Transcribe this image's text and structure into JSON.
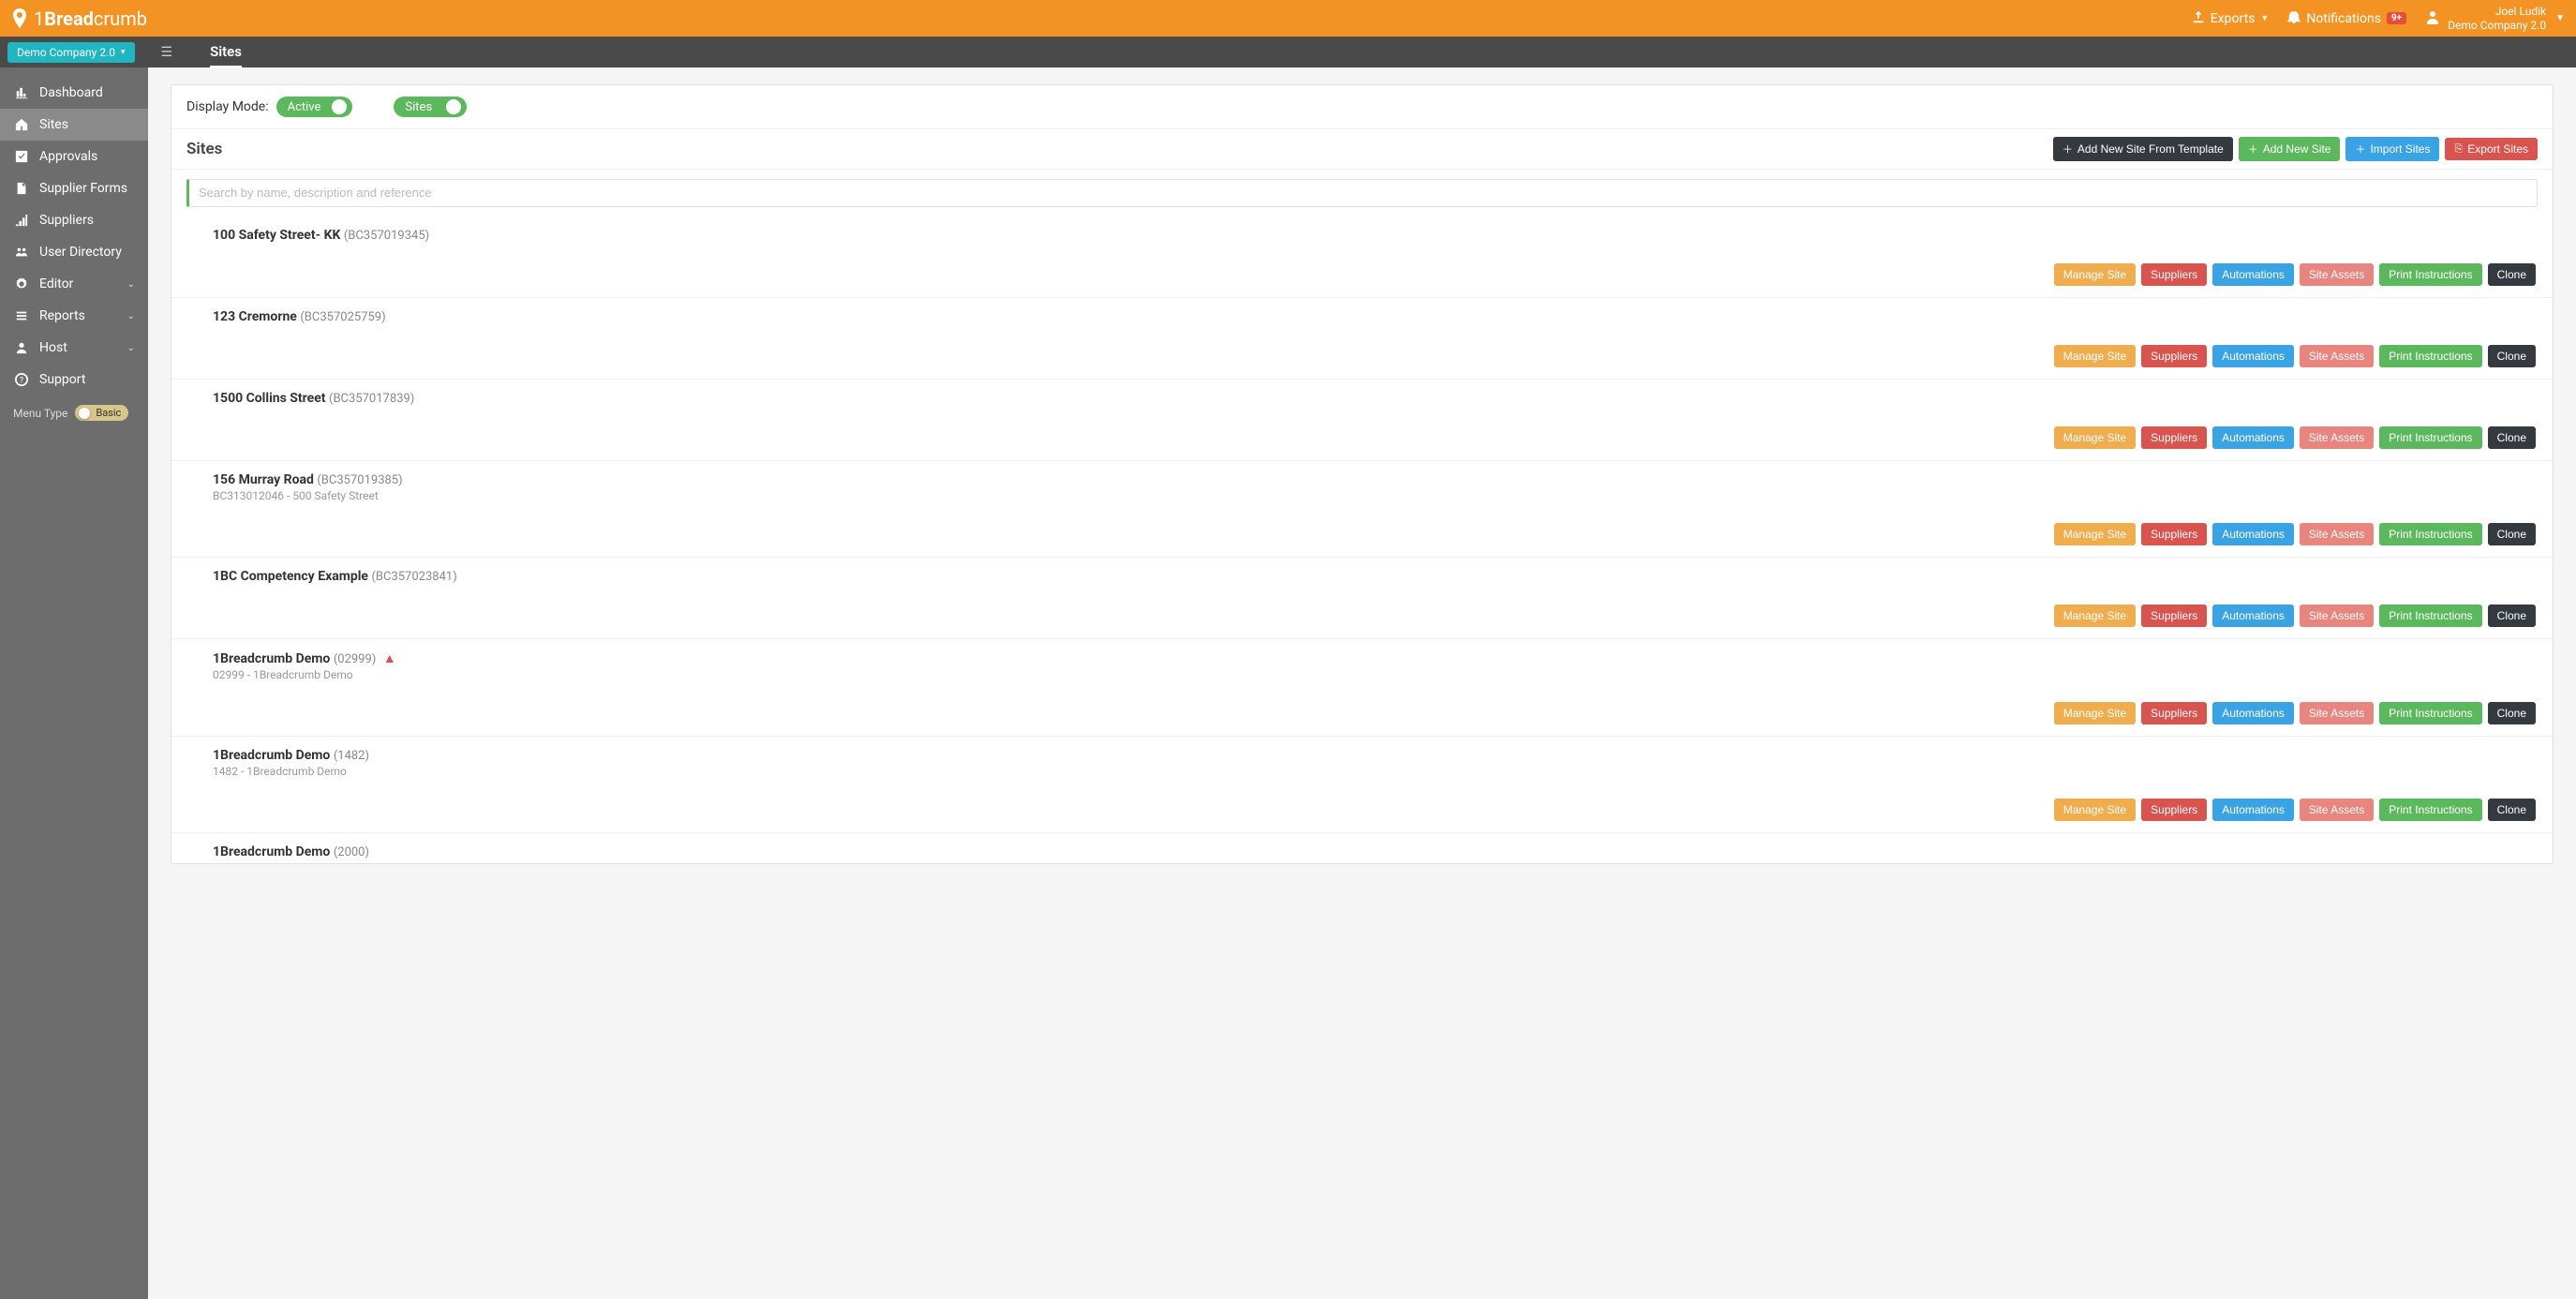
{
  "brand": {
    "pre": "1",
    "bold": "Bread",
    "rest": "crumb"
  },
  "topbar": {
    "exports": "Exports",
    "notifications": "Notifications",
    "notif_badge": "9+",
    "user_name": "Joel Ludik",
    "user_company": "Demo Company 2.0"
  },
  "subbar": {
    "company_chip": "Demo Company 2.0",
    "page_title": "Sites"
  },
  "sidebar": {
    "items": [
      {
        "label": "Dashboard"
      },
      {
        "label": "Sites"
      },
      {
        "label": "Approvals"
      },
      {
        "label": "Supplier Forms"
      },
      {
        "label": "Suppliers"
      },
      {
        "label": "User Directory"
      },
      {
        "label": "Editor"
      },
      {
        "label": "Reports"
      },
      {
        "label": "Host"
      },
      {
        "label": "Support"
      }
    ],
    "menu_type_label": "Menu Type",
    "menu_type_value": "Basic"
  },
  "main": {
    "display_mode_label": "Display Mode:",
    "toggle_active": "Active",
    "toggle_sites": "Sites",
    "sites_heading": "Sites",
    "btn_template": "Add New Site From Template",
    "btn_add": "Add New Site",
    "btn_import": "Import Sites",
    "btn_export": "Export Sites",
    "search_placeholder": "Search by name, description and reference",
    "row_buttons": {
      "manage": "Manage Site",
      "suppliers": "Suppliers",
      "automations": "Automations",
      "assets": "Site Assets",
      "print": "Print Instructions",
      "clone": "Clone"
    },
    "sites": [
      {
        "name": "100 Safety Street- KK",
        "ref": "(BC357019345)",
        "sub": "",
        "warn": false
      },
      {
        "name": "123 Cremorne",
        "ref": "(BC357025759)",
        "sub": "",
        "warn": false
      },
      {
        "name": "1500 Collins Street",
        "ref": "(BC357017839)",
        "sub": "",
        "warn": false
      },
      {
        "name": "156 Murray Road",
        "ref": "(BC357019385)",
        "sub": "BC313012046 - 500 Safety Street",
        "warn": false
      },
      {
        "name": "1BC Competency Example",
        "ref": "(BC357023841)",
        "sub": "",
        "warn": false
      },
      {
        "name": "1Breadcrumb Demo",
        "ref": "(02999)",
        "sub": "02999 - 1Breadcrumb Demo",
        "warn": true
      },
      {
        "name": "1Breadcrumb Demo",
        "ref": "(1482)",
        "sub": "1482 - 1Breadcrumb Demo",
        "warn": false
      },
      {
        "name": "1Breadcrumb Demo",
        "ref": "(2000)",
        "sub": "",
        "warn": false
      }
    ]
  }
}
